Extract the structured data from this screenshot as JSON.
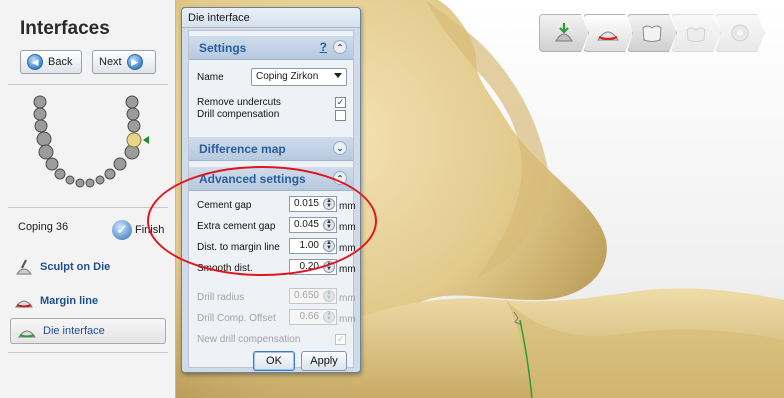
{
  "left_panel": {
    "title": "Interfaces",
    "back_label": "Back",
    "next_label": "Next",
    "coping_label": "Coping 36",
    "finish_label": "Finish",
    "tools": [
      {
        "label": "Sculpt on Die",
        "icon": "sculpt-icon"
      },
      {
        "label": "Margin line",
        "icon": "margin-line-icon"
      },
      {
        "label": "Die interface",
        "icon": "die-interface-icon"
      }
    ]
  },
  "dialog": {
    "title": "Die interface",
    "settings": {
      "header": "Settings",
      "help": "?",
      "name_label": "Name",
      "name_value": "Coping Zirkon",
      "remove_undercuts_label": "Remove undercuts",
      "remove_undercuts_checked": true,
      "drill_compensation_label": "Drill compensation",
      "drill_compensation_checked": false
    },
    "difference_map": {
      "header": "Difference map"
    },
    "advanced": {
      "header": "Advanced settings",
      "fields": [
        {
          "label": "Cement gap",
          "value": "0.015",
          "unit": "mm",
          "enabled": true
        },
        {
          "label": "Extra cement gap",
          "value": "0.045",
          "unit": "mm",
          "enabled": true
        },
        {
          "label": "Dist. to margin line",
          "value": "1.00",
          "unit": "mm",
          "enabled": true
        },
        {
          "label": "Smooth dist.",
          "value": "0.20",
          "unit": "mm",
          "enabled": true
        },
        {
          "label": "Drill radius",
          "value": "0.650",
          "unit": "mm",
          "enabled": false
        },
        {
          "label": "Drill Comp. Offset",
          "value": "0.66",
          "unit": "mm",
          "enabled": false
        }
      ],
      "new_drill_label": "New drill compensation",
      "new_drill_checked": true
    },
    "ok_label": "OK",
    "apply_label": "Apply"
  },
  "toolbar": {
    "stages": [
      {
        "icon": "die-stage-icon",
        "state": "done"
      },
      {
        "icon": "coping-stage-icon",
        "state": "active"
      },
      {
        "icon": "crown-stage-icon",
        "state": "normal"
      },
      {
        "icon": "crown-outline-stage-icon",
        "state": "disabled"
      },
      {
        "icon": "settings-stage-icon",
        "state": "disabled"
      }
    ]
  },
  "colors": {
    "annotation": "#e0151d",
    "die_surface": "#e8d39a",
    "margin_line": "#2e9b3a",
    "section_header_text": "#2a5e9c"
  }
}
